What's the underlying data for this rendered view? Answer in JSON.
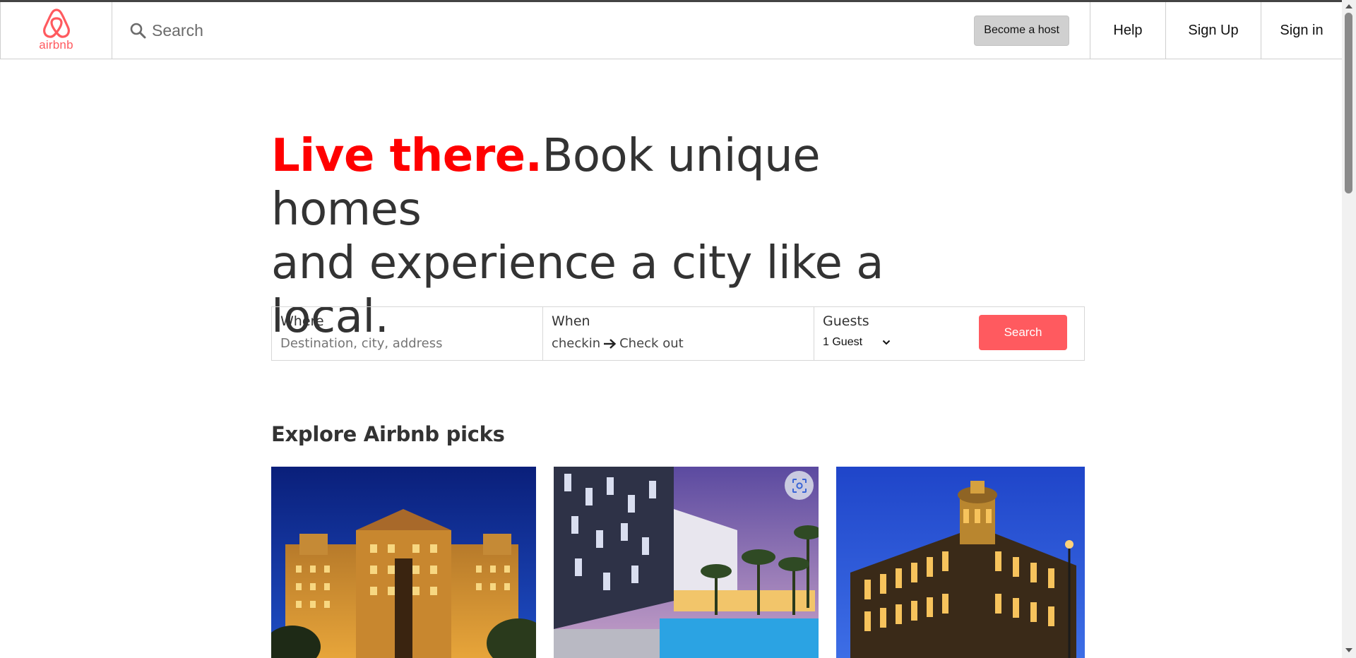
{
  "header": {
    "logo_text": "airbnb",
    "search_placeholder": "Search",
    "become_host_label": "Become a host",
    "nav": {
      "help": "Help",
      "signup": "Sign Up",
      "signin": "Sign in"
    }
  },
  "hero": {
    "accent": "Live there.",
    "line1": "Book unique homes",
    "line2": "and experience a city like a local."
  },
  "search_form": {
    "where_label": "Where",
    "where_placeholder": "Destination, city, address",
    "when_label": "When",
    "checkin_text": "checkin",
    "checkout_text": "Check out",
    "guests_label": "Guests",
    "guests_value": "1 Guest",
    "submit_label": "Search"
  },
  "explore": {
    "title": "Explore Airbnb picks"
  },
  "colors": {
    "brand": "#ff5a5f",
    "accent_red": "#ff0000",
    "text": "#333333"
  },
  "icons": [
    "airbnb-logo-icon",
    "search-icon",
    "arrow-right-icon",
    "chevron-down-icon",
    "visual-search-icon"
  ]
}
